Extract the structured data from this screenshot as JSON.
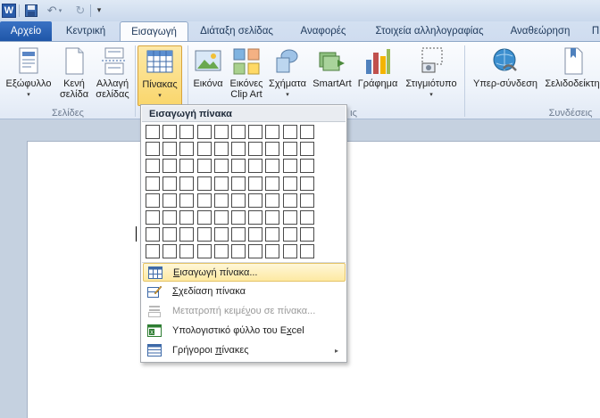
{
  "quick_access": {
    "app_icon_letter": "W",
    "undo_glyph": "↶",
    "redo_glyph": "↻",
    "customize_glyph": "▾"
  },
  "tabs": {
    "file": "Αρχείο",
    "home": "Κεντρική",
    "insert": "Εισαγωγή",
    "page_layout": "Διάταξη σελίδας",
    "references": "Αναφορές",
    "mailings": "Στοιχεία αλληλογραφίας",
    "review": "Αναθεώρηση",
    "view_partial": "Π"
  },
  "ribbon": {
    "cover_page": "Εξώφυλλο",
    "blank_page_1": "Κενή",
    "blank_page_2": "σελίδα",
    "page_break_1": "Αλλαγή",
    "page_break_2": "σελίδας",
    "table": "Πίνακας",
    "picture": "Εικόνα",
    "clip_art_1": "Εικόνες",
    "clip_art_2": "Clip Art",
    "shapes": "Σχήματα",
    "smartart": "SmartArt",
    "chart": "Γράφημα",
    "screenshot": "Στιγμιότυπο",
    "hyperlink": "Υπερ-σύνδεση",
    "bookmark": "Σελιδοδείκτη",
    "group_pages": "Σελίδες",
    "group_illustrations_tail": "ις",
    "group_links": "Συνδέσεις"
  },
  "dropdown": {
    "header": "Εισαγωγή πίνακα",
    "grid_cols": 10,
    "grid_rows": 8,
    "items": [
      {
        "label_pre": "",
        "label_ul": "Ε",
        "label_post": "ισαγωγή πίνακα..."
      },
      {
        "label_pre": "",
        "label_ul": "Σ",
        "label_post": "χεδίαση πίνακα"
      },
      {
        "label_pre": "Μετατροπή κειμέ",
        "label_ul": "ν",
        "label_post": "ου σε πίνακα..."
      },
      {
        "label_pre": "Υπολογιστικό φύλλο του E",
        "label_ul": "x",
        "label_post": "cel"
      },
      {
        "label_pre": "Γρήγοροι ",
        "label_ul": "π",
        "label_post": "ίνακες"
      }
    ],
    "submenu_arrow": "▸"
  },
  "colors": {
    "file_tab": "#2a62b6",
    "highlight": "#fde9a2",
    "table_icon_blue": "#3e6aa8"
  }
}
